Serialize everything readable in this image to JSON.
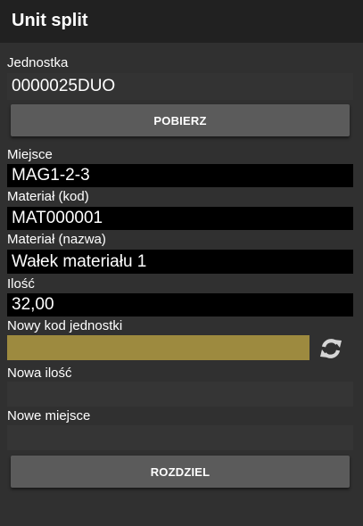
{
  "appbar": {
    "title": "Unit split"
  },
  "unit": {
    "label": "Jednostka",
    "value": "0000025DUO"
  },
  "fetch_button": {
    "label": "POBIERZ"
  },
  "location": {
    "label": "Miejsce",
    "value": "MAG1-2-3"
  },
  "material_code": {
    "label": "Materiał (kod)",
    "value": "MAT000001"
  },
  "material_name": {
    "label": "Materiał (nazwa)",
    "value": "Wałek materiału 1"
  },
  "quantity": {
    "label": "Ilość",
    "value": "32,00"
  },
  "new_unit_code": {
    "label": "Nowy kod jednostki",
    "value": "",
    "icon": "refresh-icon"
  },
  "new_quantity": {
    "label": "Nowa ilość",
    "value": ""
  },
  "new_location": {
    "label": "Nowe miejsce",
    "value": ""
  },
  "split_button": {
    "label": "ROZDZIEL"
  },
  "colors": {
    "appbar": "#212121",
    "background": "#303030",
    "readonly_field": "#000000",
    "active_field": "#9d8a3f",
    "button": "#5b5b5b"
  }
}
